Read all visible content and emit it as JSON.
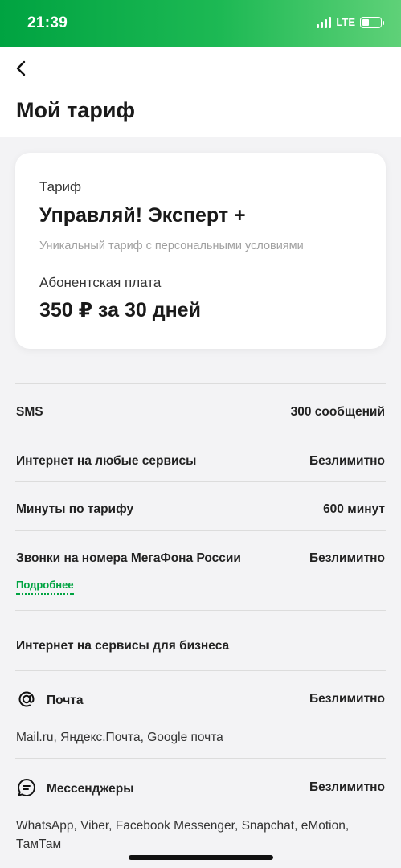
{
  "status_bar": {
    "time": "21:39",
    "network": "LTE"
  },
  "header": {
    "title": "Мой тариф"
  },
  "tariff_card": {
    "label": "Тариф",
    "name": "Управляй! Эксперт +",
    "description": "Уникальный тариф с персональными условиями",
    "fee_label": "Абонентская плата",
    "fee_value": "350 ₽ за 30 дней"
  },
  "rows": [
    {
      "label": "SMS",
      "value": "300 сообщений"
    },
    {
      "label": "Интернет на любые сервисы",
      "value": "Безлимитно"
    },
    {
      "label": "Минуты по тарифу",
      "value": "600 минут"
    },
    {
      "label": "Звонки на номера МегаФона России",
      "value": "Безлимитно",
      "link": "Подробнее"
    }
  ],
  "business_section": {
    "title": "Интернет на сервисы для бизнеса",
    "services": [
      {
        "icon": "at-icon",
        "name": "Почта",
        "value": "Безлимитно",
        "description": "Mail.ru, Яндекс.Почта, Google почта"
      },
      {
        "icon": "chat-icon",
        "name": "Мессенджеры",
        "value": "Безлимитно",
        "description": "WhatsApp, Viber, Facebook Messenger, Snapchat, eMotion, ТамТам"
      }
    ]
  },
  "colors": {
    "accent": "#00a341",
    "background": "#f3f3f5",
    "card": "#ffffff"
  }
}
